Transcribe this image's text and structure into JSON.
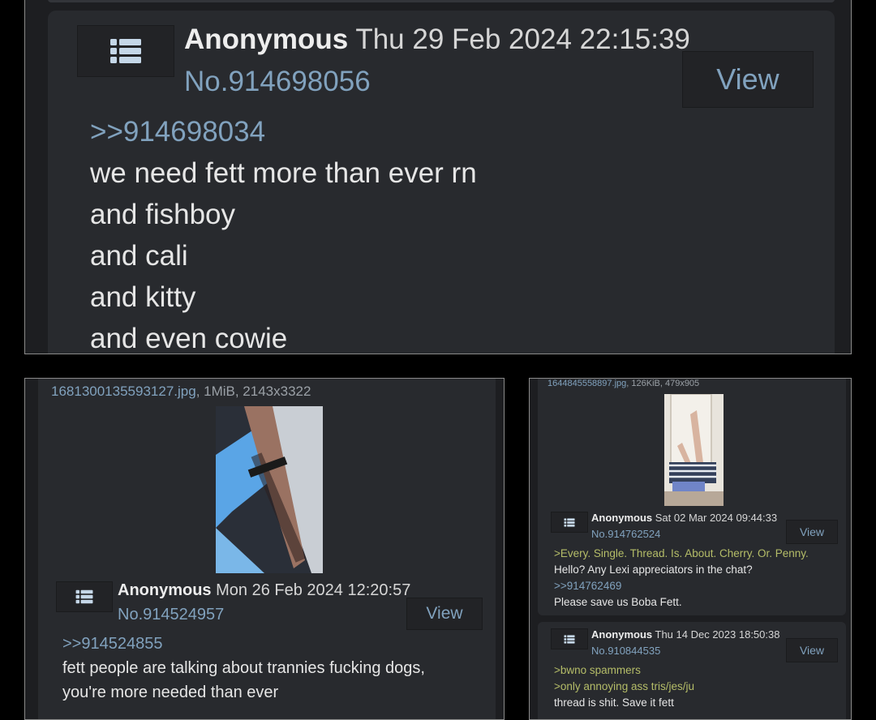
{
  "top_post": {
    "name": "Anonymous",
    "date": "Thu 29 Feb 2024 22:15:39",
    "number": "No.914698056",
    "view_label": "View",
    "quote": ">>914698034",
    "lines": [
      "we need fett more than ever rn",
      "and fishboy",
      "and cali",
      "and kitty",
      "and even cowie"
    ]
  },
  "left_post": {
    "file_name": "1681300135593127.jpg",
    "file_meta": ", 1MiB, 2143x3322",
    "name": "Anonymous",
    "date": "Mon 26 Feb 2024 12:20:57",
    "number": "No.914524957",
    "view_label": "View",
    "quote": ">>914524855",
    "lines": [
      "fett people are talking about trannies fucking dogs,",
      "you're more needed than ever"
    ]
  },
  "right_post_1": {
    "file_name": "1644845558897.jpg",
    "file_meta": ", 126KiB, 479x905",
    "name": "Anonymous",
    "date": "Sat 02 Mar 2024 09:44:33",
    "number": "No.914762524",
    "view_label": "View",
    "greentext": ">Every. Single. Thread. Is. About. Cherry. Or. Penny.",
    "line1": "Hello? Any Lexi appreciators in the chat?",
    "quote": ">>914762469",
    "line2": "Please save us Boba Fett."
  },
  "right_post_2": {
    "name": "Anonymous",
    "date": "Thu 14 Dec 2023 18:50:38",
    "number": "No.910844535",
    "view_label": "View",
    "greentext": [
      ">bwno spammers",
      ">only annoying ass tris/jes/ju"
    ],
    "line": "thread is shit. Save it fett"
  },
  "colors": {
    "background": "#000000",
    "post_bg": "#282a2e",
    "link": "#81a2be",
    "greentext": "#b5bd68",
    "text": "#e6e6e6"
  },
  "icons": [
    "list-icon"
  ]
}
